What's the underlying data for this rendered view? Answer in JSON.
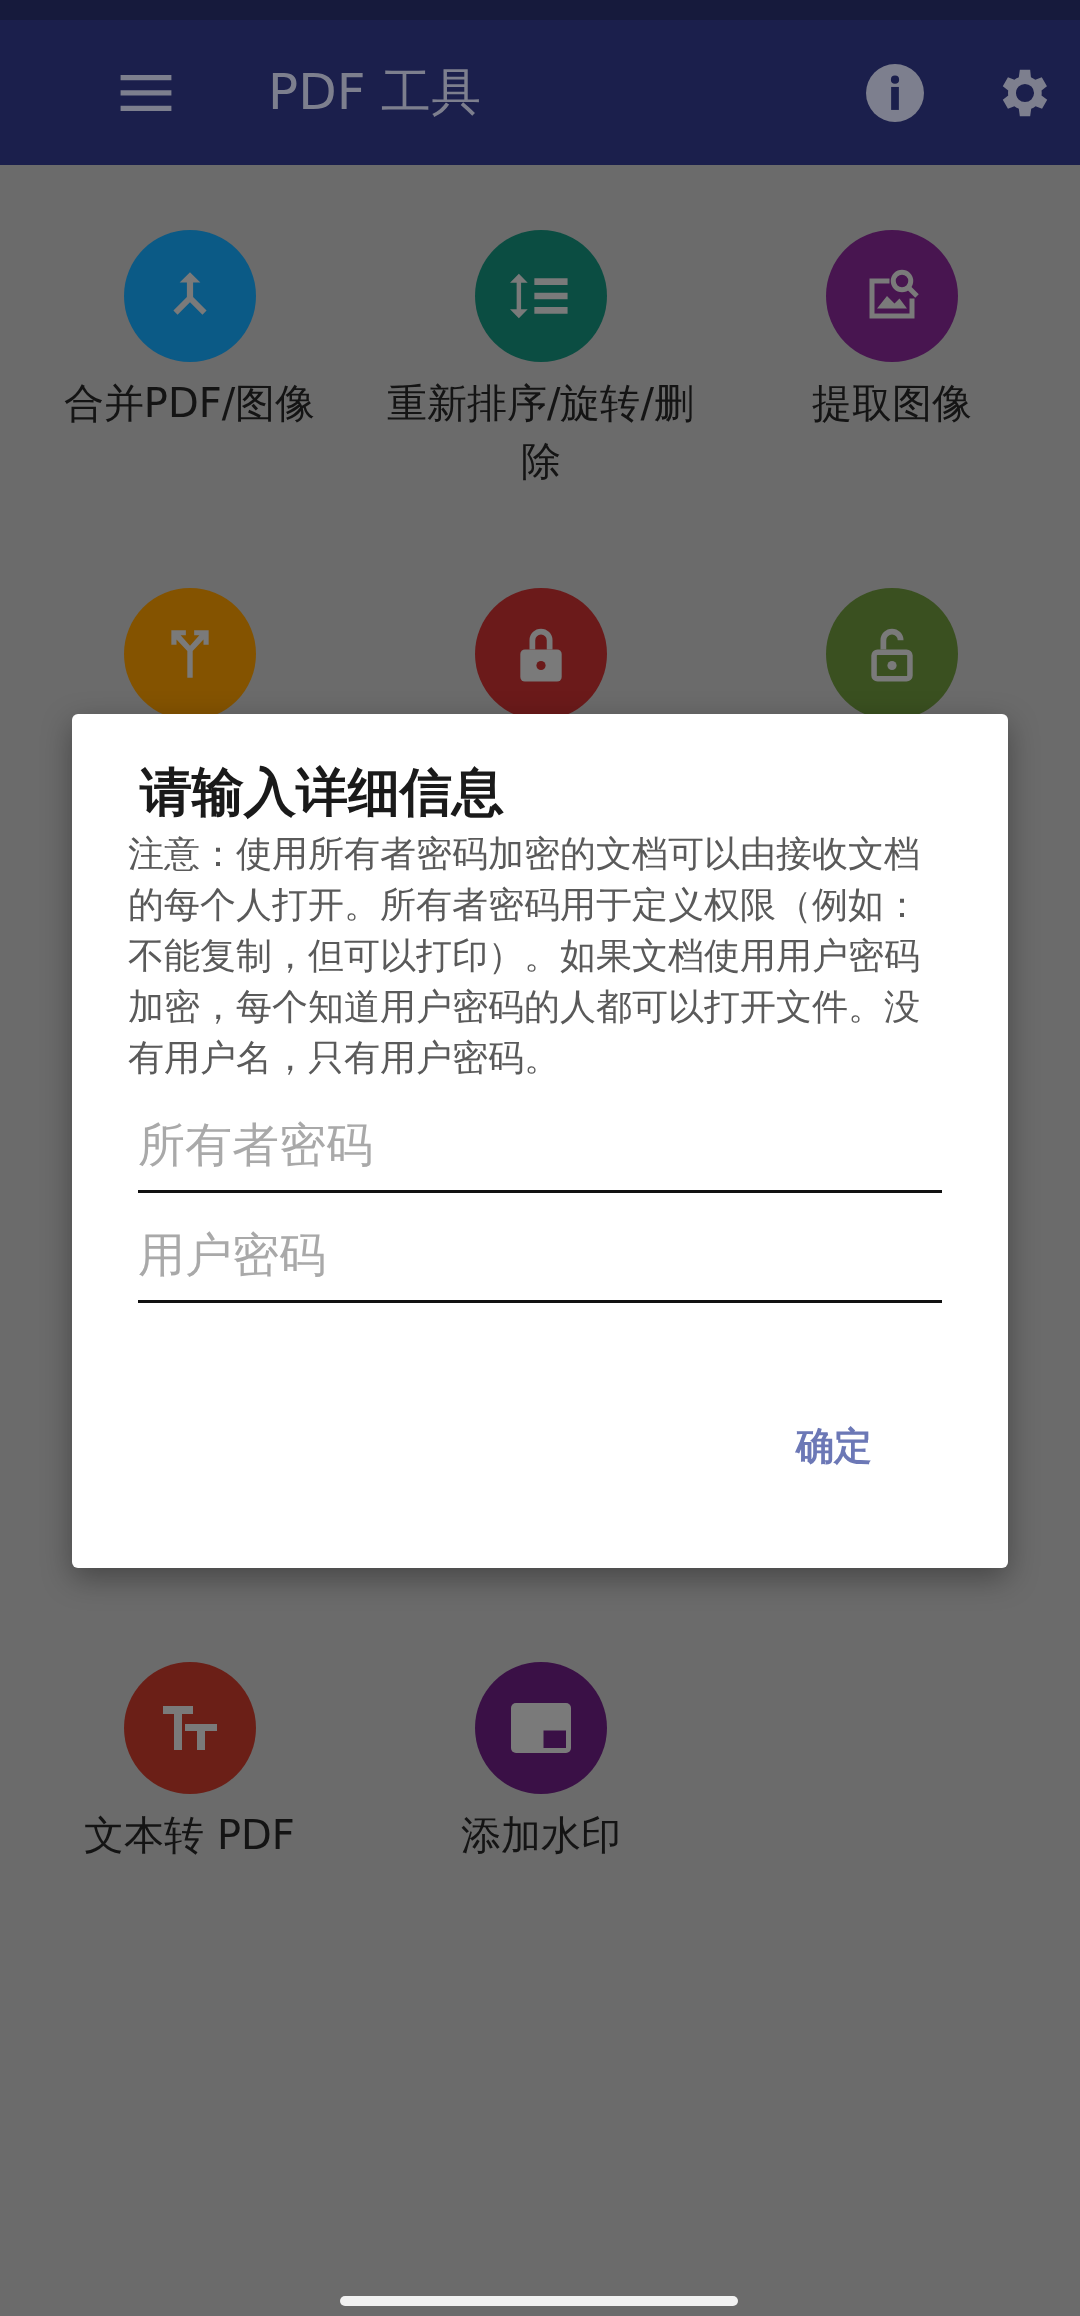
{
  "app_bar": {
    "title": "PDF 工具"
  },
  "tool_rows": [
    [
      {
        "label": "合并PDF/图像",
        "color": "#0b5a86"
      },
      {
        "label": "重新排序/旋转/删除",
        "color": "#0b4d42"
      },
      {
        "label": "提取图像",
        "color": "#481550"
      }
    ],
    [
      {
        "color": "#845300"
      },
      {
        "color": "#6b1a1a"
      },
      {
        "color": "#3a5020"
      }
    ],
    [
      {
        "label": "文本转 PDF",
        "color": "#6b1f17"
      },
      {
        "label": "添加水印",
        "color": "#3a1046"
      }
    ]
  ],
  "dialog": {
    "title": "请输入详细信息",
    "note": "注意：使用所有者密码加密的文档可以由接收文档的每个人打开。所有者密码用于定义权限（例如：不能复制，但可以打印）。如果文档使用用户密码加密，每个知道用户密码的人都可以打开文件。没有用户名，只有用户密码。",
    "fields": [
      {
        "placeholder": "所有者密码"
      },
      {
        "placeholder": "用户密码"
      }
    ],
    "confirm": "确定"
  }
}
